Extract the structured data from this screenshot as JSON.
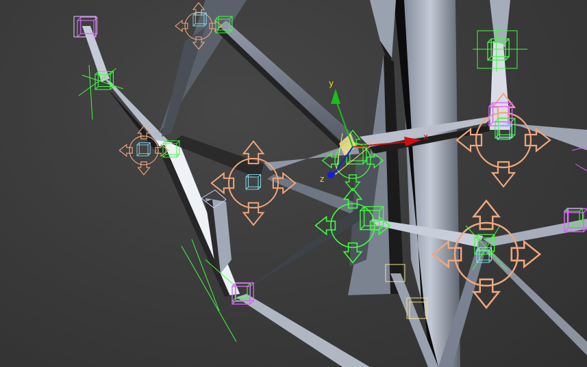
{
  "viewport": {
    "background": "#3c3c3c",
    "geometry_color": "#a9b1bf",
    "control_green": "#3cff3c",
    "control_orange": "#f0a77c",
    "control_magenta": "#e060ff",
    "control_cyan": "#8fe8ff",
    "control_yellow": "#f5e08a"
  },
  "gizmo": {
    "x_label": "x",
    "y_label": "y",
    "z_label": "z",
    "x_color": "#d01010",
    "y_color": "#18c018",
    "z_color": "#1020e0",
    "center_color": "#ffff00"
  }
}
